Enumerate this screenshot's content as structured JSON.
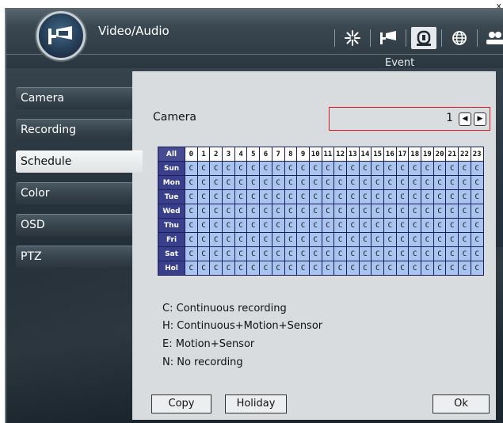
{
  "window": {
    "close_glyph": "x"
  },
  "header": {
    "title": "Video/Audio",
    "tools": [
      {
        "name": "settings-icon",
        "active": false
      },
      {
        "name": "video-audio-icon",
        "active": false
      },
      {
        "name": "event-icon",
        "active": true
      },
      {
        "name": "network-icon",
        "active": false
      },
      {
        "name": "users-icon",
        "active": false
      }
    ],
    "active_tool_label": "Event"
  },
  "sidebar": {
    "items": [
      {
        "label": "Camera",
        "active": false
      },
      {
        "label": "Recording",
        "active": false
      },
      {
        "label": "Schedule",
        "active": true
      },
      {
        "label": "Color",
        "active": false
      },
      {
        "label": "OSD",
        "active": false
      },
      {
        "label": "PTZ",
        "active": false
      }
    ]
  },
  "panel": {
    "camera_label": "Camera",
    "camera_value": "1",
    "prev_glyph": "◀",
    "next_glyph": "▶",
    "schedule": {
      "corner_label": "All",
      "hours": [
        "0",
        "1",
        "2",
        "3",
        "4",
        "5",
        "6",
        "7",
        "8",
        "9",
        "10",
        "11",
        "12",
        "13",
        "14",
        "15",
        "16",
        "17",
        "18",
        "19",
        "20",
        "21",
        "22",
        "23"
      ],
      "rows": [
        {
          "day": "Sun",
          "cells": [
            "C",
            "C",
            "C",
            "C",
            "C",
            "C",
            "C",
            "C",
            "C",
            "C",
            "C",
            "C",
            "C",
            "C",
            "C",
            "C",
            "C",
            "C",
            "C",
            "C",
            "C",
            "C",
            "C",
            "C"
          ]
        },
        {
          "day": "Mon",
          "cells": [
            "C",
            "C",
            "C",
            "C",
            "C",
            "C",
            "C",
            "C",
            "C",
            "C",
            "C",
            "C",
            "C",
            "C",
            "C",
            "C",
            "C",
            "C",
            "C",
            "C",
            "C",
            "C",
            "C",
            "C"
          ]
        },
        {
          "day": "Tue",
          "cells": [
            "C",
            "C",
            "C",
            "C",
            "C",
            "C",
            "C",
            "C",
            "C",
            "C",
            "C",
            "C",
            "C",
            "C",
            "C",
            "C",
            "C",
            "C",
            "C",
            "C",
            "C",
            "C",
            "C",
            "C"
          ]
        },
        {
          "day": "Wed",
          "cells": [
            "C",
            "C",
            "C",
            "C",
            "C",
            "C",
            "C",
            "C",
            "C",
            "C",
            "C",
            "C",
            "C",
            "C",
            "C",
            "C",
            "C",
            "C",
            "C",
            "C",
            "C",
            "C",
            "C",
            "C"
          ]
        },
        {
          "day": "Thu",
          "cells": [
            "C",
            "C",
            "C",
            "C",
            "C",
            "C",
            "C",
            "C",
            "C",
            "C",
            "C",
            "C",
            "C",
            "C",
            "C",
            "C",
            "C",
            "C",
            "C",
            "C",
            "C",
            "C",
            "C",
            "C"
          ]
        },
        {
          "day": "Fri",
          "cells": [
            "C",
            "C",
            "C",
            "C",
            "C",
            "C",
            "C",
            "C",
            "C",
            "C",
            "C",
            "C",
            "C",
            "C",
            "C",
            "C",
            "C",
            "C",
            "C",
            "C",
            "C",
            "C",
            "C",
            "C"
          ]
        },
        {
          "day": "Sat",
          "cells": [
            "C",
            "C",
            "C",
            "C",
            "C",
            "C",
            "C",
            "C",
            "C",
            "C",
            "C",
            "C",
            "C",
            "C",
            "C",
            "C",
            "C",
            "C",
            "C",
            "C",
            "C",
            "C",
            "C",
            "C"
          ]
        },
        {
          "day": "Hol",
          "cells": [
            "C",
            "C",
            "C",
            "C",
            "C",
            "C",
            "C",
            "C",
            "C",
            "C",
            "C",
            "C",
            "C",
            "C",
            "C",
            "C",
            "C",
            "C",
            "C",
            "C",
            "C",
            "C",
            "C",
            "C"
          ]
        }
      ]
    },
    "legend": [
      "C: Continuous recording",
      "H: Continuous+Motion+Sensor",
      "E: Motion+Sensor",
      "N: No recording"
    ],
    "buttons": {
      "copy": "Copy",
      "holiday": "Holiday",
      "ok": "Ok"
    }
  },
  "colors": {
    "cell_fill": "#a9c4ef",
    "day_header": "#3a3f8c",
    "highlight_border": "#e01a1a"
  }
}
